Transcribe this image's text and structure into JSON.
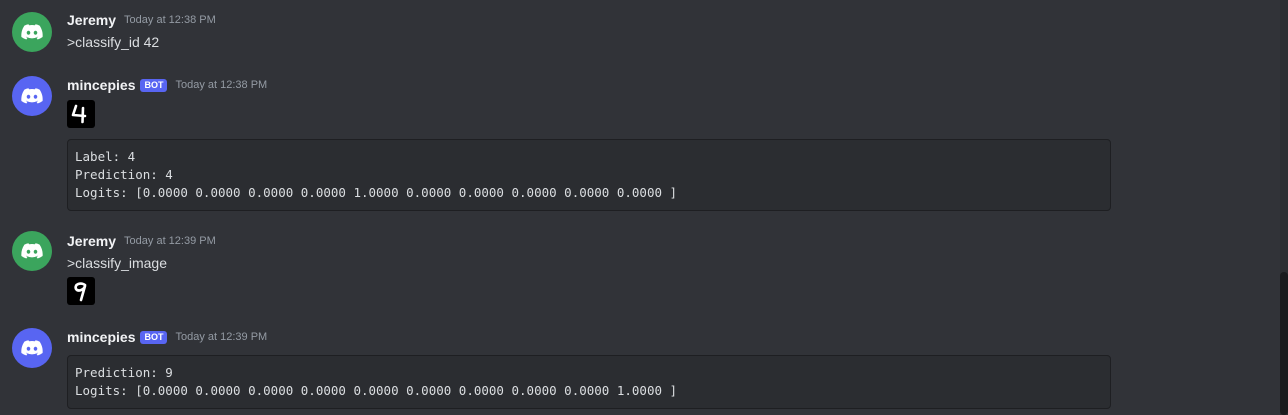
{
  "colors": {
    "background": "#313338",
    "user_avatar": "#3ba55d",
    "bot_avatar": "#5865f2",
    "bot_tag": "#5865f2",
    "codeblock_bg": "#2b2d31"
  },
  "messages": [
    {
      "author": "Jeremy",
      "avatar_icon": "discord-icon",
      "timestamp": "Today at 12:38 PM",
      "text": ">classify_id 42"
    },
    {
      "author": "mincepies",
      "bot_tag": "BOT",
      "avatar_icon": "discord-icon",
      "timestamp": "Today at 12:38 PM",
      "image_digit": "4",
      "code": [
        "Label: 4",
        "Prediction: 4",
        "Logits: [0.0000 0.0000 0.0000 0.0000 1.0000 0.0000 0.0000 0.0000 0.0000 0.0000 ]"
      ]
    },
    {
      "author": "Jeremy",
      "avatar_icon": "discord-icon",
      "timestamp": "Today at 12:39 PM",
      "text": ">classify_image",
      "image_digit": "9"
    },
    {
      "author": "mincepies",
      "bot_tag": "BOT",
      "avatar_icon": "discord-icon",
      "timestamp": "Today at 12:39 PM",
      "code": [
        "Prediction: 9",
        "Logits: [0.0000 0.0000 0.0000 0.0000 0.0000 0.0000 0.0000 0.0000 0.0000 1.0000 ]"
      ]
    }
  ]
}
